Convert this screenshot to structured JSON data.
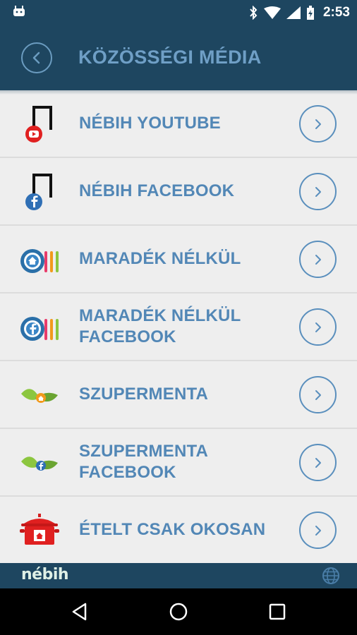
{
  "status_bar": {
    "time": "2:53",
    "icons": [
      "android-icon",
      "bluetooth-icon",
      "wifi-icon",
      "signal-icon",
      "battery-icon"
    ]
  },
  "app_bar": {
    "title": "KÖZÖSSÉGI MÉDIA",
    "back_icon": "chevron-left-icon"
  },
  "list": {
    "items": [
      {
        "label": "NÉBIH YOUTUBE",
        "icon": "nebih-youtube-logo"
      },
      {
        "label": "NÉBIH FACEBOOK",
        "icon": "nebih-facebook-logo"
      },
      {
        "label": "MARADÉK NÉLKÜL",
        "icon": "maradek-nelkul-logo"
      },
      {
        "label": "MARADÉK NÉLKÜL FACEBOOK",
        "icon": "maradek-nelkul-facebook-logo"
      },
      {
        "label": "SZUPERMENTA",
        "icon": "szupermenta-logo"
      },
      {
        "label": "SZUPERMENTA FACEBOOK",
        "icon": "szupermenta-facebook-logo"
      },
      {
        "label": "ÉTELT CSAK OKOSAN",
        "icon": "etelt-csak-okosan-logo"
      }
    ],
    "row_action_icon": "chevron-right-icon"
  },
  "footer": {
    "brand": "nébih",
    "language_icon": "globe-icon"
  },
  "nav_bar": {
    "buttons": [
      "back-triangle-icon",
      "home-circle-icon",
      "recents-square-icon"
    ]
  },
  "colors": {
    "header_bg": "#1e4660",
    "title_text": "#6f9fc6",
    "list_bg": "#eeeeee",
    "row_text": "#5287b6",
    "chevron_outline": "#5a8fbd",
    "youtube_red": "#e02020",
    "facebook_blue": "#2f6fb5",
    "leaf_green": "#8cc63f"
  }
}
